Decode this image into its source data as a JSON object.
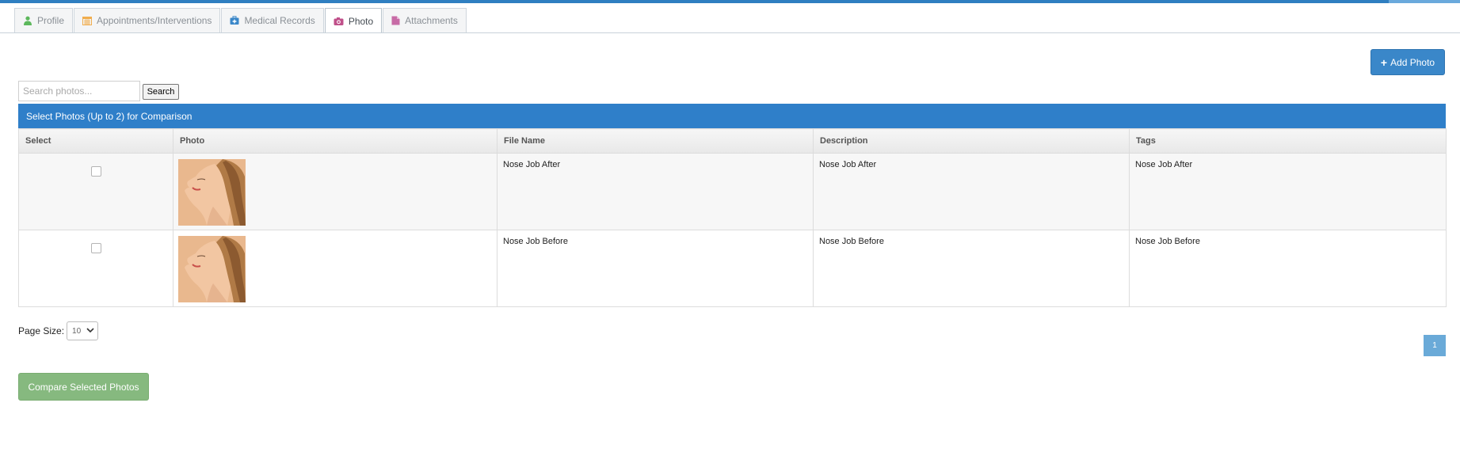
{
  "tabs": [
    {
      "label": "Profile",
      "icon": "user-icon",
      "color": "#5cb85c"
    },
    {
      "label": "Appointments/Interventions",
      "icon": "calendar-icon",
      "color": "#f0ad4e"
    },
    {
      "label": "Medical Records",
      "icon": "medkit-icon",
      "color": "#3a87c9"
    },
    {
      "label": "Photo",
      "icon": "camera-icon",
      "color": "#c0508a",
      "active": true
    },
    {
      "label": "Attachments",
      "icon": "file-icon",
      "color": "#c76ba6"
    }
  ],
  "toolbar": {
    "add_photo_label": "Add Photo",
    "add_icon": "plus-icon"
  },
  "search": {
    "placeholder": "Search photos...",
    "value": "",
    "button_label": "Search"
  },
  "panel": {
    "title": "Select Photos (Up to 2) for Comparison"
  },
  "table": {
    "columns": [
      "Select",
      "Photo",
      "File Name",
      "Description",
      "Tags"
    ],
    "rows": [
      {
        "checked": false,
        "file_name": "Nose Job After",
        "description": "Nose Job After",
        "tags": "Nose Job After"
      },
      {
        "checked": false,
        "file_name": "Nose Job Before",
        "description": "Nose Job Before",
        "tags": "Nose Job Before"
      }
    ]
  },
  "pagination": {
    "page_size_label": "Page Size:",
    "page_size_value": "10",
    "current_page": "1"
  },
  "compare_button_label": "Compare Selected Photos",
  "colors": {
    "primary": "#2f7fc9",
    "success": "#86b97f",
    "pager": "#6aaad8"
  }
}
